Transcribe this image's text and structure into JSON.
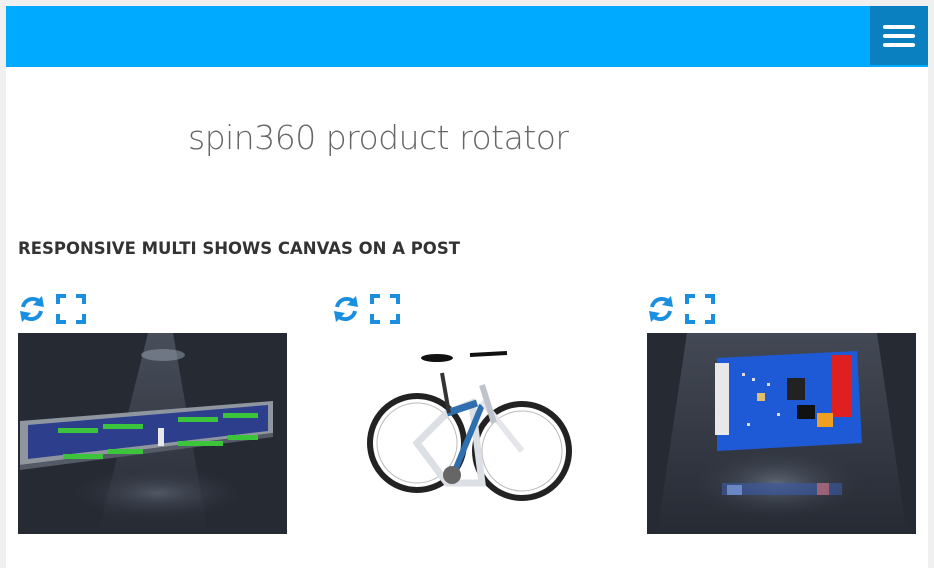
{
  "header": {
    "menu_icon": "hamburger-menu-icon",
    "accent": "#00aaff",
    "menu_bg": "#0b80c0"
  },
  "site": {
    "title": "spin360 product rotator"
  },
  "post": {
    "heading": "RESPONSIVE MULTI SHOWS CANVAS ON A POST"
  },
  "viewers": [
    {
      "name": "rack-panel-viewer",
      "rotate_icon": "rotate-icon",
      "fullscreen_icon": "fullscreen-icon",
      "background": "#262a33"
    },
    {
      "name": "bicycle-viewer",
      "rotate_icon": "rotate-icon",
      "fullscreen_icon": "fullscreen-icon",
      "background": "#ffffff"
    },
    {
      "name": "circuit-board-viewer",
      "rotate_icon": "rotate-icon",
      "fullscreen_icon": "fullscreen-icon",
      "background": "#262a33"
    }
  ],
  "icon_color": "#1a8fe0"
}
